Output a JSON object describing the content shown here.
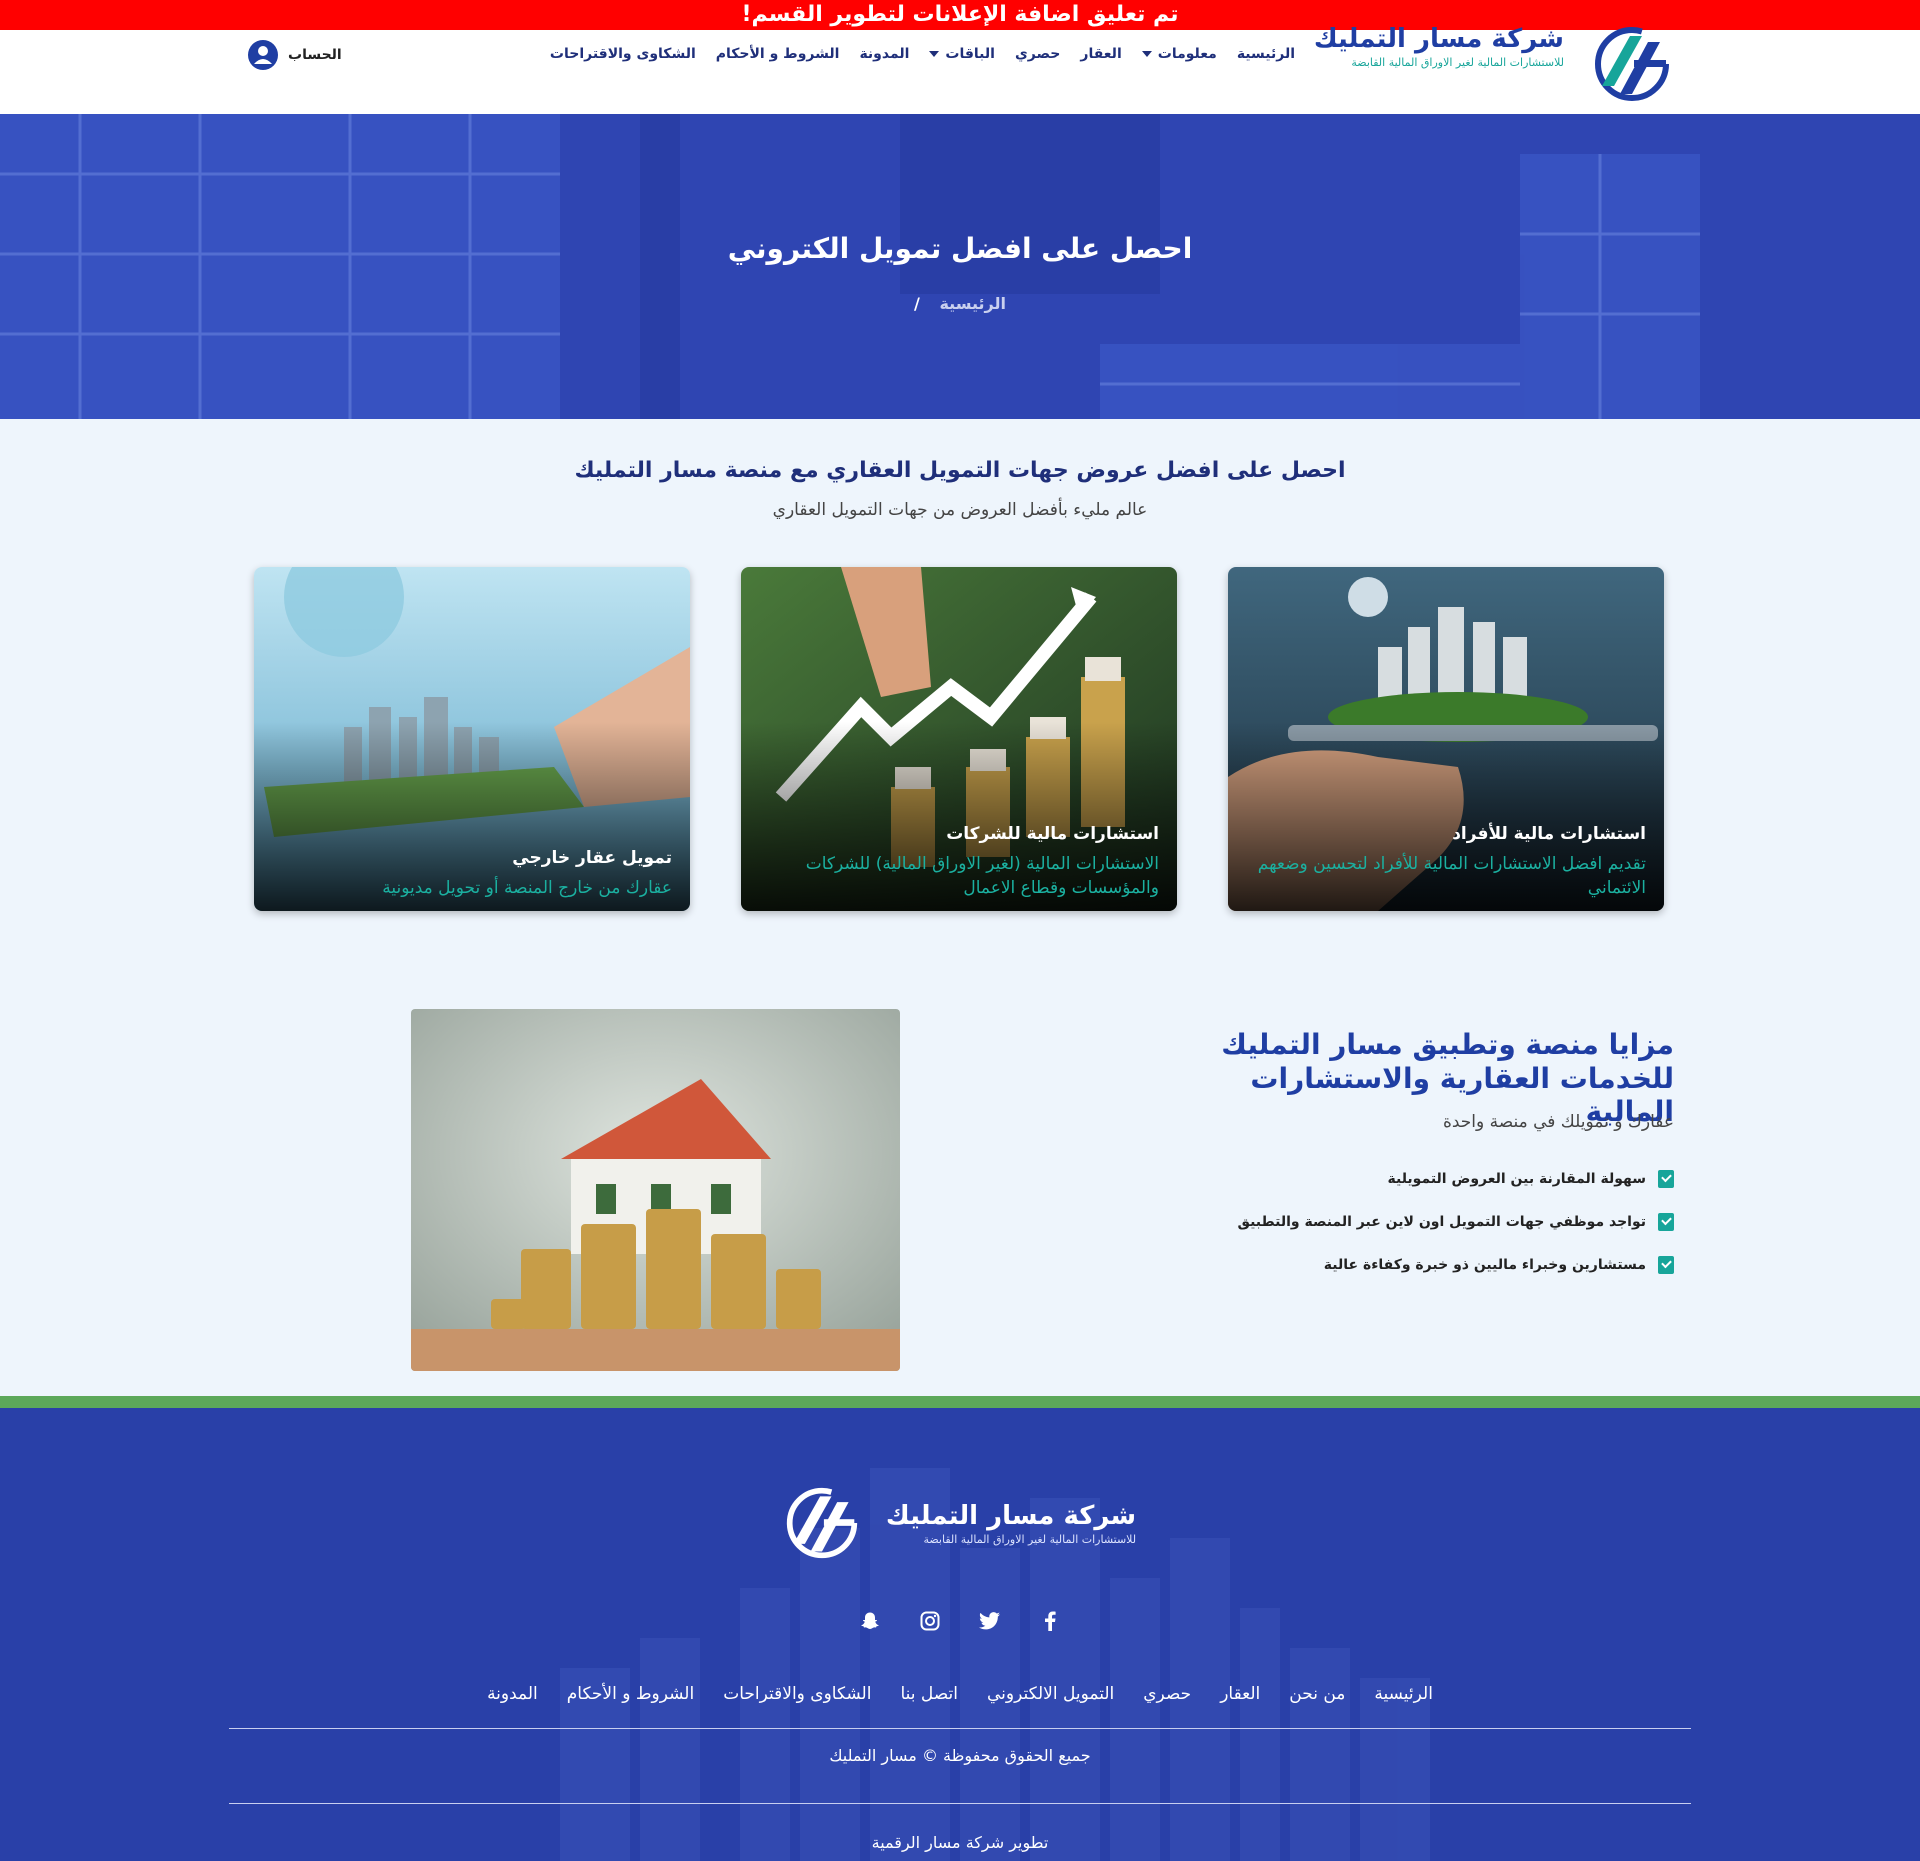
{
  "announcement": "تم تعليق اضافة الإعلانات لتطوير القسم!",
  "brand": {
    "name": "شركة مسار التمليك",
    "tagline": "للاستشارات المالية لغير الاوراق المالية القابضة"
  },
  "nav": {
    "items": [
      {
        "label": "الرئيسية",
        "dropdown": false
      },
      {
        "label": "معلومات",
        "dropdown": true
      },
      {
        "label": "العقار",
        "dropdown": false
      },
      {
        "label": "حصري",
        "dropdown": false
      },
      {
        "label": "الباقات",
        "dropdown": true
      },
      {
        "label": "المدونة",
        "dropdown": false
      },
      {
        "label": "الشروط و الأحكام",
        "dropdown": false
      },
      {
        "label": "الشكاوى والاقتراحات",
        "dropdown": false
      }
    ],
    "account_label": "الحساب"
  },
  "hero": {
    "title": "احصل على افضل تمويل الكتروني",
    "breadcrumb_home": "الرئيسية",
    "breadcrumb_sep": "/"
  },
  "offers": {
    "title": "احصل على افضل عروض جهات التمويل العقاري مع منصة مسار التمليك",
    "subtitle": "عالم مليء بأفضل العروض من جهات التمويل العقاري",
    "cards": [
      {
        "title": "استشارات مالية للأفراد",
        "desc": "تقديم افضل الاستشارات المالية للأفراد لتحسين وضعهم الائتماني"
      },
      {
        "title": "استشارات مالية للشركات",
        "desc": "الاستشارات المالية (لغير الاوراق المالية) للشركات والمؤسسات وقطاع الاعمال"
      },
      {
        "title": "تمويل عقار خارجي",
        "desc": "عقارك من خارج المنصة أو تحويل مديونية"
      }
    ]
  },
  "features": {
    "title": "مزايا منصة وتطبيق مسار التمليك للخدمات العقارية والاستشارات المالية",
    "subtitle": "عقارك و تمويلك في منصة واحدة",
    "items": [
      "سهولة المقارنة بين العروض التمويلية",
      "تواجد موظفي جهات التمويل اون لاين عبر المنصة والتطبيق",
      "مستشارين وخبراء ماليين ذو خبرة وكفاءة عالية"
    ]
  },
  "footer": {
    "social": [
      "facebook-icon",
      "twitter-icon",
      "instagram-icon",
      "snapchat-icon"
    ],
    "links": [
      "الرئيسية",
      "من نحن",
      "العقار",
      "حصري",
      "التمويل الالكتروني",
      "اتصل بنا",
      "الشكاوى والاقتراحات",
      "الشروط و الأحكام",
      "المدونة"
    ],
    "copyright": "جميع الحقوق محفوظة © مسار التمليك",
    "developed_by": "تطوير شركة مسار الرقمية"
  },
  "colors": {
    "primary": "#1f3ea3",
    "accent": "#17a59a",
    "announcement": "#ff0000",
    "footer": "#2940a8"
  }
}
